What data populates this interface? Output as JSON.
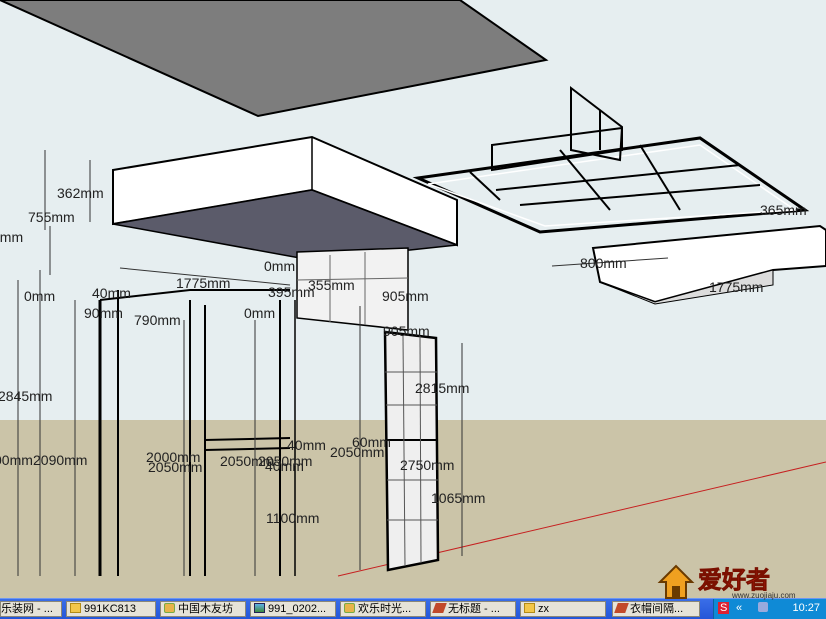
{
  "scene": {
    "dimensions": [
      "362mm",
      "755mm",
      "0mm",
      "0mm",
      "2845mm",
      "00mm",
      "2090mm",
      "1775mm",
      "40mm",
      "90mm",
      "790mm",
      "0mm",
      "395mm",
      "355mm",
      "905mm",
      "0mm",
      "905mm",
      "2000mm",
      "2050mm",
      "2050mm",
      "2050mm",
      "40mm",
      "60mm",
      "40mm",
      "2050mm",
      "2815mm",
      "2750mm",
      "1065mm",
      "1100mm",
      "800mm",
      "1775mm",
      "365mm"
    ]
  },
  "taskbar": {
    "items": [
      {
        "label": "乐装网 - ...",
        "icon": "globe-icon"
      },
      {
        "label": "991KC813",
        "icon": "folder-icon"
      },
      {
        "label": "中国木友坊",
        "icon": "app-icon"
      },
      {
        "label": "991_0202...",
        "icon": "image-icon"
      },
      {
        "label": "欢乐时光...",
        "icon": "app-icon"
      },
      {
        "label": "无标题 - ...",
        "icon": "pen-icon"
      },
      {
        "label": "zx",
        "icon": "folder-icon"
      },
      {
        "label": "衣帽间隔...",
        "icon": "pen-icon"
      }
    ],
    "tray": {
      "clock": "10:27",
      "expand_label": "«",
      "ime_label": "S"
    }
  },
  "watermark": {
    "brand": "爱好者",
    "url": "www.zuojiaju.com"
  }
}
